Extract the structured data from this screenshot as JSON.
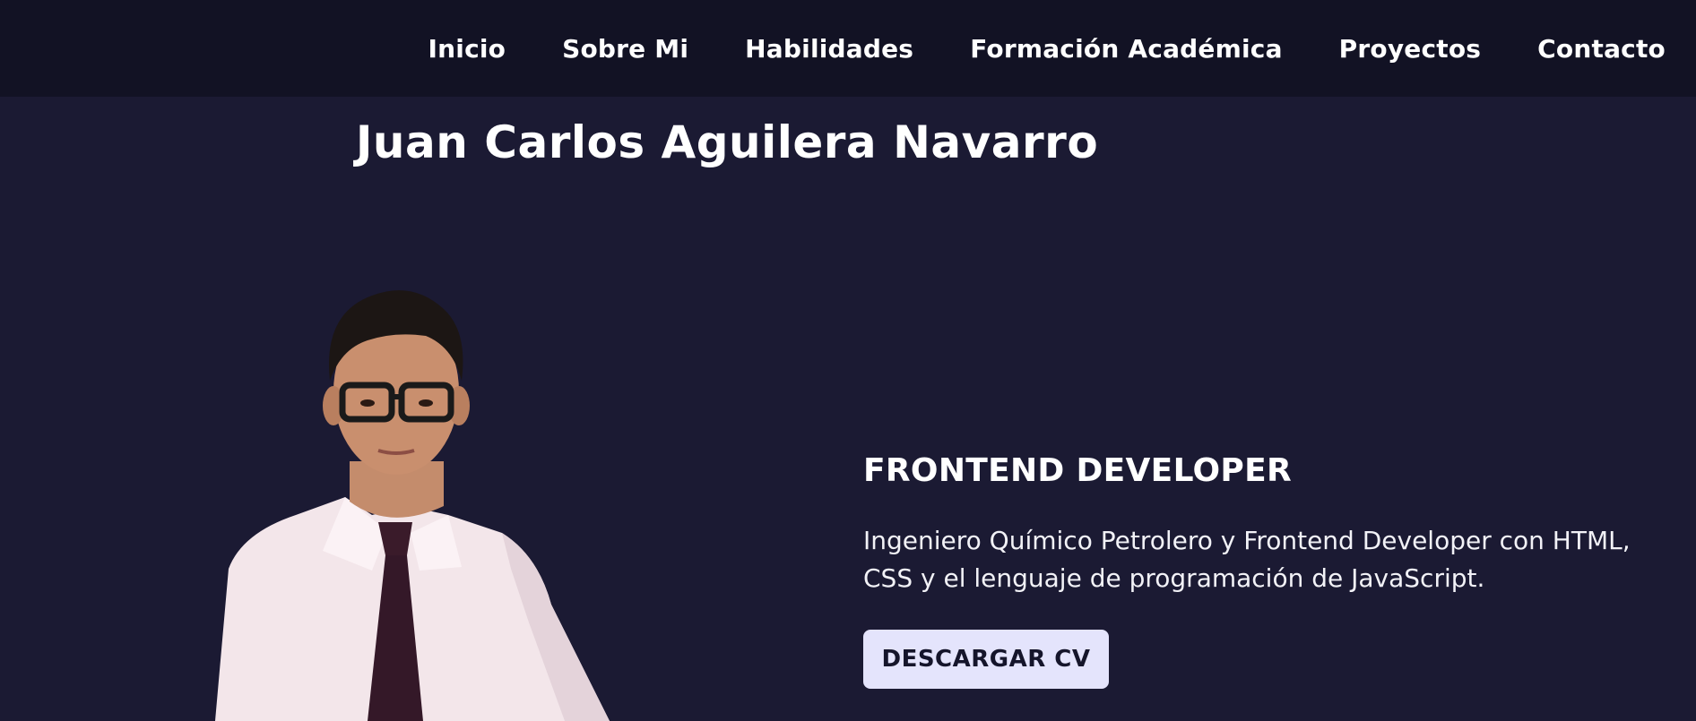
{
  "nav": {
    "items": [
      {
        "label": "Inicio"
      },
      {
        "label": "Sobre Mi"
      },
      {
        "label": "Habilidades"
      },
      {
        "label": "Formación Académica"
      },
      {
        "label": "Proyectos"
      },
      {
        "label": "Contacto"
      }
    ]
  },
  "hero": {
    "name": "Juan Carlos Aguilera Navarro",
    "role": "FRONTEND DEVELOPER",
    "description": "Ingeniero Químico Petrolero y Frontend Developer con HTML, CSS y el lenguaje de programación de JavaScript.",
    "cv_button_label": "DESCARGAR CV"
  },
  "colors": {
    "background": "#1b1a33",
    "navbar": "#121224",
    "button_bg": "#e4e4fc",
    "button_text": "#15152b"
  }
}
